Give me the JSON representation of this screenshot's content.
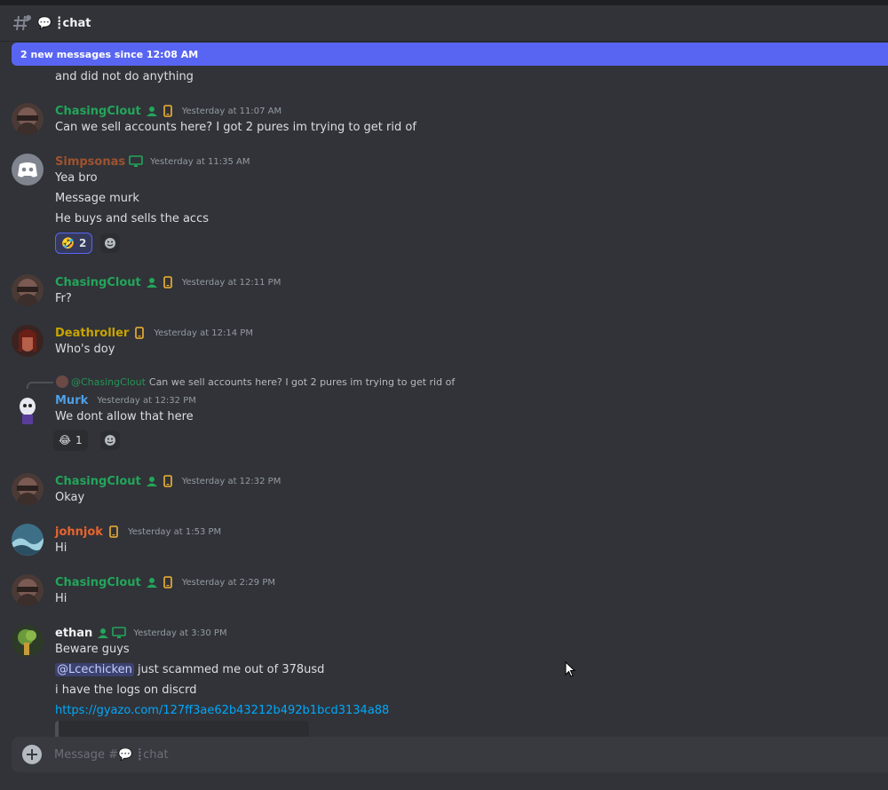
{
  "channel": {
    "title": "💬 ┋chat",
    "icon": "hashtag-threads-icon"
  },
  "new_messages_bar": "2 new messages since 12:08 AM",
  "colors": {
    "chasingclout": "#23a55a",
    "simpsonas": "#a0522d",
    "deathroller": "#c9a300",
    "murk": "#4e9fe6",
    "johnjok": "#e8642d",
    "ethan": "#f2f3f5",
    "accent": "#5865f2"
  },
  "messages": [
    {
      "continuation": "and did not do anything"
    },
    {
      "author": "ChasingClout",
      "timestamp": "Yesterday at 11:07 AM",
      "badges": [
        "role-badge-icon",
        "mobile-icon"
      ],
      "lines": [
        "Can we sell accounts here? I got 2 pures im trying to get rid of"
      ]
    },
    {
      "author": "Simpsonas",
      "timestamp": "Yesterday at 11:35 AM",
      "badges": [
        "desktop-icon"
      ],
      "lines": [
        "Yea bro",
        "Message murk",
        "He buys and sells the accs"
      ],
      "reaction": {
        "emoji": "🤣",
        "count": "2"
      }
    },
    {
      "author": "ChasingClout",
      "timestamp": "Yesterday at 12:11 PM",
      "lines": [
        "Fr?"
      ]
    },
    {
      "author": "Deathroller",
      "timestamp": "Yesterday at 12:14 PM",
      "lines": [
        "Who's doy"
      ]
    },
    {
      "reply_to": {
        "author": "@ChasingClout",
        "text": "Can we sell accounts here? I got 2 pures im trying to get rid of"
      },
      "author": "Murk",
      "timestamp": "Yesterday at 12:32 PM",
      "lines": [
        "We dont allow that here"
      ],
      "reaction": {
        "emoji": "😂",
        "count": "1"
      }
    },
    {
      "author": "ChasingClout",
      "timestamp": "Yesterday at 12:32 PM",
      "lines": [
        "Okay"
      ]
    },
    {
      "author": "johnjok",
      "timestamp": "Yesterday at 1:53 PM",
      "lines": [
        "Hi"
      ]
    },
    {
      "author": "ChasingClout",
      "timestamp": "Yesterday at 2:29 PM",
      "lines": [
        "Hi"
      ]
    },
    {
      "author": "ethan",
      "timestamp": "Yesterday at 3:30 PM",
      "lines": [
        "Beware guys",
        "just scammed me out of 378usd",
        "i have the logs on discrd"
      ],
      "mention": "@Lcechicken",
      "link": "https://gyazo.com/127ff3ae62b43212b492b1bcd3134a88"
    }
  ],
  "composer": {
    "placeholder": "Message #💬 ┋chat"
  }
}
